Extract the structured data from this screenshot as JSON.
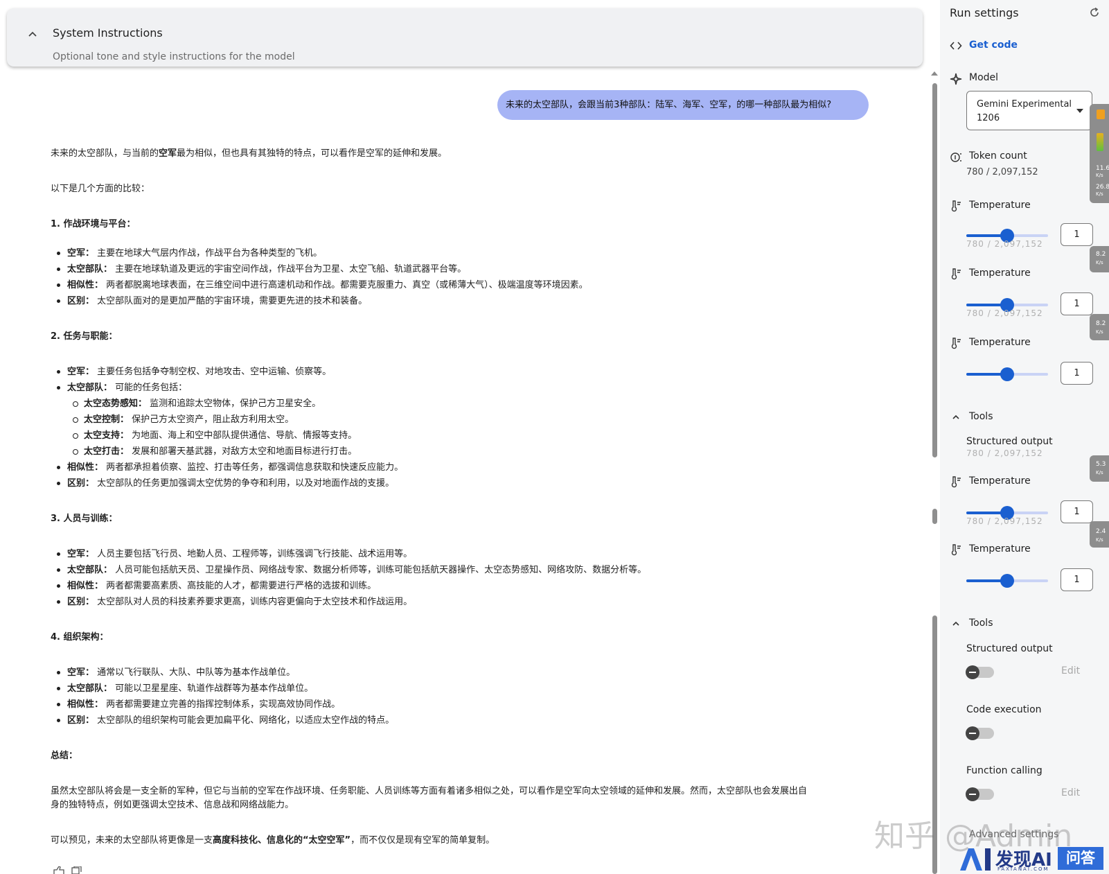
{
  "system_instructions": {
    "title": "System Instructions",
    "subtitle": "Optional tone and style instructions for the model"
  },
  "chat": {
    "user_message": "未来的太空部队，会跟当前3种部队：陆军、海军、空军，的哪一种部队最为相似?",
    "answer": {
      "intro_pre": "未来的太空部队，与当前的",
      "intro_bold": "空军",
      "intro_post": "最为相似，但也具有其独特的特点，可以看作是空军的延伸和发展。",
      "compare_intro": "以下是几个方面的比较：",
      "sections": [
        {
          "heading": "1. 作战环境与平台：",
          "items": [
            {
              "label": "空军：",
              "text": "主要在地球大气层内作战，作战平台为各种类型的飞机。"
            },
            {
              "label": "太空部队：",
              "text": "主要在地球轨道及更远的宇宙空间作战，作战平台为卫星、太空飞船、轨道武器平台等。"
            },
            {
              "label": "相似性：",
              "text": "两者都脱离地球表面，在三维空间中进行高速机动和作战。都需要克服重力、真空（或稀薄大气）、极端温度等环境因素。"
            },
            {
              "label": "区别：",
              "text": "太空部队面对的是更加严酷的宇宙环境，需要更先进的技术和装备。"
            }
          ]
        },
        {
          "heading": "2. 任务与职能：",
          "items": [
            {
              "label": "空军：",
              "text": "主要任务包括争夺制空权、对地攻击、空中运输、侦察等。"
            },
            {
              "label": "太空部队：",
              "text": "可能的任务包括："
            }
          ],
          "subitems": [
            {
              "label": "太空态势感知：",
              "text": "监测和追踪太空物体，保护己方卫星安全。"
            },
            {
              "label": "太空控制：",
              "text": "保护己方太空资产，阻止敌方利用太空。"
            },
            {
              "label": "太空支持：",
              "text": "为地面、海上和空中部队提供通信、导航、情报等支持。"
            },
            {
              "label": "太空打击：",
              "text": "发展和部署天基武器，对敌方太空和地面目标进行打击。"
            }
          ],
          "items_after": [
            {
              "label": "相似性：",
              "text": "两者都承担着侦察、监控、打击等任务，都强调信息获取和快速反应能力。"
            },
            {
              "label": "区别：",
              "text": "太空部队的任务更加强调太空优势的争夺和利用，以及对地面作战的支援。"
            }
          ]
        },
        {
          "heading": "3. 人员与训练：",
          "items": [
            {
              "label": "空军：",
              "text": "人员主要包括飞行员、地勤人员、工程师等，训练强调飞行技能、战术运用等。"
            },
            {
              "label": "太空部队：",
              "text": "人员可能包括航天员、卫星操作员、网络战专家、数据分析师等，训练可能包括航天器操作、太空态势感知、网络攻防、数据分析等。"
            },
            {
              "label": "相似性：",
              "text": "两者都需要高素质、高技能的人才，都需要进行严格的选拔和训练。"
            },
            {
              "label": "区别：",
              "text": "太空部队对人员的科技素养要求更高，训练内容更偏向于太空技术和作战运用。"
            }
          ]
        },
        {
          "heading": "4. 组织架构：",
          "items": [
            {
              "label": "空军：",
              "text": "通常以飞行联队、大队、中队等为基本作战单位。"
            },
            {
              "label": "太空部队：",
              "text": "可能以卫星星座、轨道作战群等为基本作战单位。"
            },
            {
              "label": "相似性：",
              "text": "两者都需要建立完善的指挥控制体系，实现高效协同作战。"
            },
            {
              "label": "区别：",
              "text": "太空部队的组织架构可能会更加扁平化、网络化，以适应太空作战的特点。"
            }
          ]
        }
      ],
      "summary_heading": "总结：",
      "summary_line1": "虽然太空部队将会是一支全新的军种，但它与当前的空军在作战环境、任务职能、人员训练等方面有着诸多相似之处，可以看作是空军向太空领域的延伸和发展。然而，太空部队也会发展出自",
      "summary_line2": "身的独特特点，例如更强调太空技术、信息战和网络战能力。",
      "final_pre": "可以预见，未来的太空部队将更像是一支",
      "final_bold": "高度科技化、信息化的“太空空军”",
      "final_post": "，而不仅仅是现有空军的简单复制。"
    }
  },
  "run_settings": {
    "title": "Run settings",
    "get_code": "Get code",
    "model_label": "Model",
    "model_value_line1": "Gemini Experimental",
    "model_value_line2": "1206",
    "token_label": "Token count",
    "token_value": "780 / 2,097,152",
    "temperature_label": "Temperature",
    "temperature_value": "1",
    "temperature_fraction": 0.5,
    "ghost_text": "780 / 2,097,152",
    "tools_label": "Tools",
    "structured_output": "Structured output",
    "code_execution": "Code execution",
    "function_calling": "Function calling",
    "edit_label": "Edit",
    "advanced_settings": "Advanced settings"
  },
  "side_widget": {
    "values": [
      "11.6",
      "26.8",
      "8.2",
      "8.2",
      "5.3",
      "2.4"
    ],
    "unit": "K/s"
  },
  "watermark": {
    "zhihu": "知乎 @Admin",
    "brand": "发现AI",
    "brand_url": "FAXIANAI.COM",
    "badge": "问答"
  },
  "colors": {
    "accent": "#1a5fd0",
    "user_bubble": "#a6b4f5",
    "panel_bg": "#f5f6f7"
  }
}
